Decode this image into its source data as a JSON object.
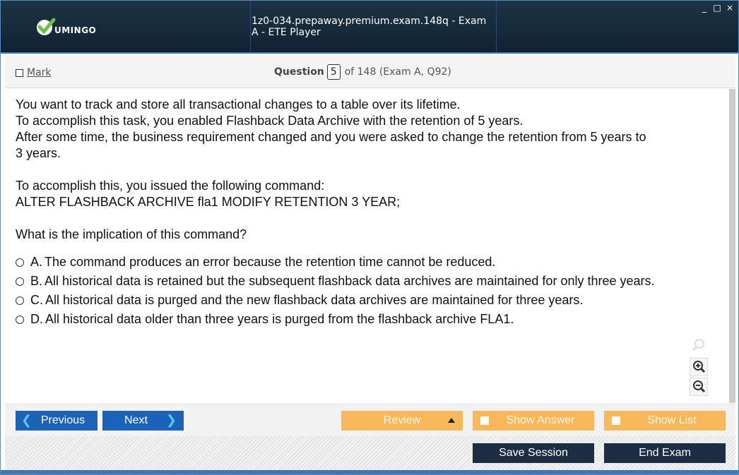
{
  "window": {
    "title": "1z0-034.prepaway.premium.exam.148q - Exam A - ETE Player",
    "logo_text": "UMINGO",
    "controls": [
      "_",
      "□",
      "×"
    ]
  },
  "question_bar": {
    "mark_label": "Mark",
    "question_label": "Question",
    "question_number": "5",
    "question_total": "of 148 (Exam A, Q92)"
  },
  "question": {
    "lines": [
      "You want to track and store all transactional changes to a table over its lifetime.",
      "To accomplish this task, you enabled Flashback Data Archive with the retention of 5 years.",
      "After some time, the business requirement changed and you were asked to change the retention from 5 years to",
      "3 years.",
      "To accomplish this, you issued the following command:",
      "ALTER FLASHBACK ARCHIVE fla1 MODIFY RETENTION 3 YEAR;",
      "What is the implication of this command?"
    ],
    "options": [
      {
        "letter": "A.",
        "text": "The command produces an error because the retention time cannot be reduced."
      },
      {
        "letter": "B.",
        "text": "All historical data is retained but the subsequent flashback data archives are maintained for only three years."
      },
      {
        "letter": "C.",
        "text": "All historical data is purged and the new flashback data archives are maintained for three years."
      },
      {
        "letter": "D.",
        "text": "All historical data older than three years is purged from the flashback archive FLA1."
      }
    ]
  },
  "icons": {
    "search": "magnifier-icon",
    "zoom_in": "zoom-in-icon",
    "zoom_out": "zoom-out-icon",
    "prev": "chevron-left-icon",
    "next": "chevron-right-icon",
    "review_menu": "triangle-up-icon"
  },
  "nav": {
    "previous": "Previous",
    "next": "Next",
    "review": "Review",
    "show_answer": "Show Answer",
    "show_list": "Show List"
  },
  "footer": {
    "save_session": "Save Session",
    "end_exam": "End Exam"
  },
  "colors": {
    "titlebar": "#1d3446",
    "accent_blue": "#1a63b8",
    "accent_orange": "#f6b85a",
    "dark_button": "#1c2e44",
    "logo_green": "#6cc04a"
  }
}
